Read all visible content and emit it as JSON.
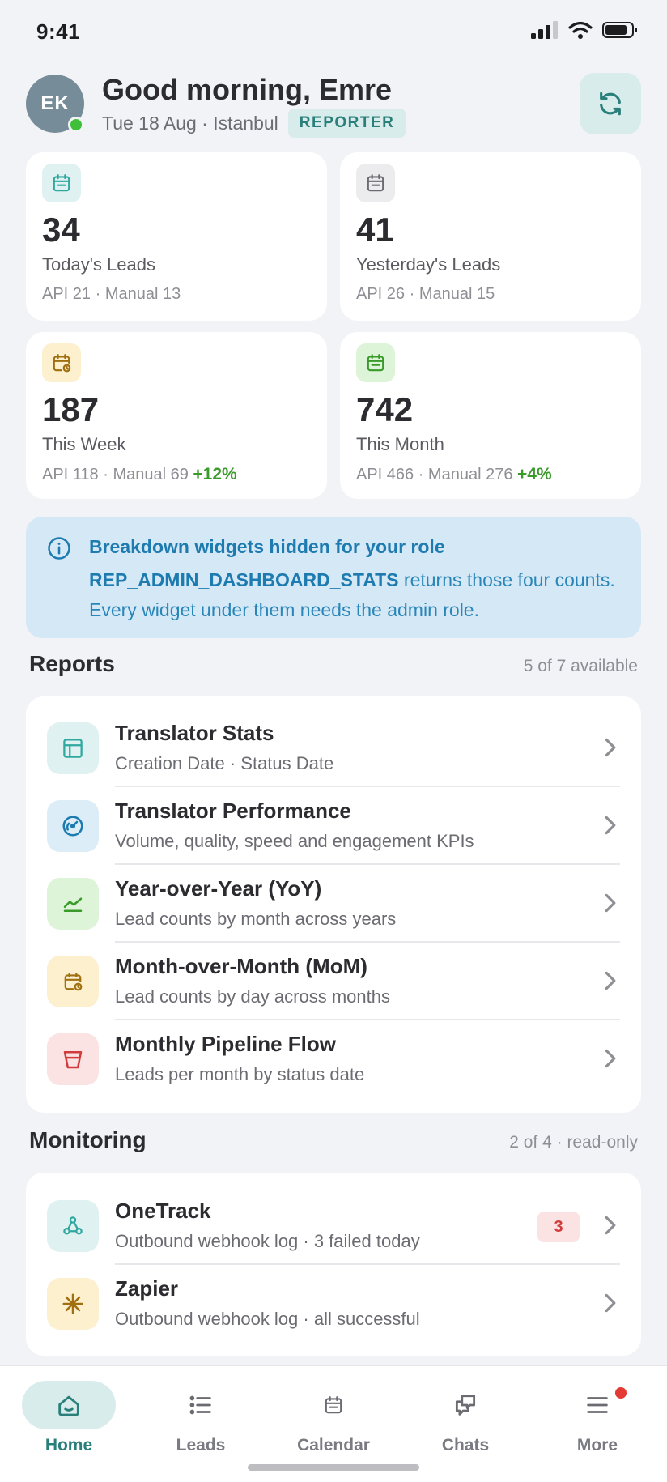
{
  "status_bar": {
    "time": "9:41"
  },
  "header": {
    "avatar_initials": "EK",
    "greeting": "Good morning, Emre",
    "subline": "Tue 18 Aug · Istanbul",
    "role_badge": "REPORTER",
    "refresh_icon": "refresh-icon"
  },
  "stats": [
    {
      "value": "34",
      "label": "Today's Leads",
      "meta": "API 21 · Manual 13",
      "trend": "",
      "icon": "calendar-icon",
      "accent": "#2fa8a0",
      "icon_bg": "#dff1f0"
    },
    {
      "value": "41",
      "label": "Yesterday's Leads",
      "meta": "API 26 · Manual 15",
      "trend": "",
      "icon": "calendar-icon",
      "accent": "#6b6b72",
      "icon_bg": "#ececef"
    },
    {
      "value": "187",
      "label": "This Week",
      "meta": "API 118 · Manual 69",
      "trend": "+12%",
      "icon": "calendar-clock-icon",
      "accent": "#a07010",
      "icon_bg": "#fdf0cf"
    },
    {
      "value": "742",
      "label": "This Month",
      "meta": "API 466 · Manual 276",
      "trend": "+4%",
      "icon": "calendar-icon",
      "accent": "#3a9a2a",
      "icon_bg": "#def4d8"
    }
  ],
  "info_banner": {
    "title": "Breakdown widgets hidden for your role",
    "code": "REP_ADMIN_DASHBOARD_STATS",
    "body_after_code": " returns those four counts. Every widget under them needs the admin role."
  },
  "reports": {
    "title": "Reports",
    "meta": "5 of 7 available",
    "items": [
      {
        "title": "Translator Stats",
        "subtitle": "Creation Date · Status Date",
        "icon": "table-icon",
        "accent": "#2fa8a0",
        "icon_bg": "#dff1f0"
      },
      {
        "title": "Translator Performance",
        "subtitle": "Volume, quality, speed and engagement KPIs",
        "icon": "gauge-icon",
        "accent": "#1d7bb0",
        "icon_bg": "#dcedf8"
      },
      {
        "title": "Year-over-Year (YoY)",
        "subtitle": "Lead counts by month across years",
        "icon": "line-chart-icon",
        "accent": "#3a9a2a",
        "icon_bg": "#def4d8"
      },
      {
        "title": "Month-over-Month (MoM)",
        "subtitle": "Lead counts by day across months",
        "icon": "calendar-clock-icon",
        "accent": "#a07010",
        "icon_bg": "#fdf0cf"
      },
      {
        "title": "Monthly Pipeline Flow",
        "subtitle": "Leads per month by status date",
        "icon": "funnel-icon",
        "accent": "#d23b3b",
        "icon_bg": "#fbe3e3"
      }
    ]
  },
  "monitoring": {
    "title": "Monitoring",
    "meta": "2 of 4 · read-only",
    "items": [
      {
        "title": "OneTrack",
        "subtitle": "Outbound webhook log · 3 failed today",
        "badge": "3",
        "icon": "webhook-icon",
        "accent": "#2fa8a0",
        "icon_bg": "#dff1f0"
      },
      {
        "title": "Zapier",
        "subtitle": "Outbound webhook log · all successful",
        "badge": "",
        "icon": "asterisk-icon",
        "accent": "#a07010",
        "icon_bg": "#fdf0cf"
      }
    ]
  },
  "tabs": [
    {
      "label": "Home",
      "icon": "home-icon",
      "active": true
    },
    {
      "label": "Leads",
      "icon": "list-icon",
      "active": false
    },
    {
      "label": "Calendar",
      "icon": "calendar-icon",
      "active": false
    },
    {
      "label": "Chats",
      "icon": "chat-icon",
      "active": false
    },
    {
      "label": "More",
      "icon": "menu-icon",
      "active": false,
      "has_notification": true
    }
  ]
}
